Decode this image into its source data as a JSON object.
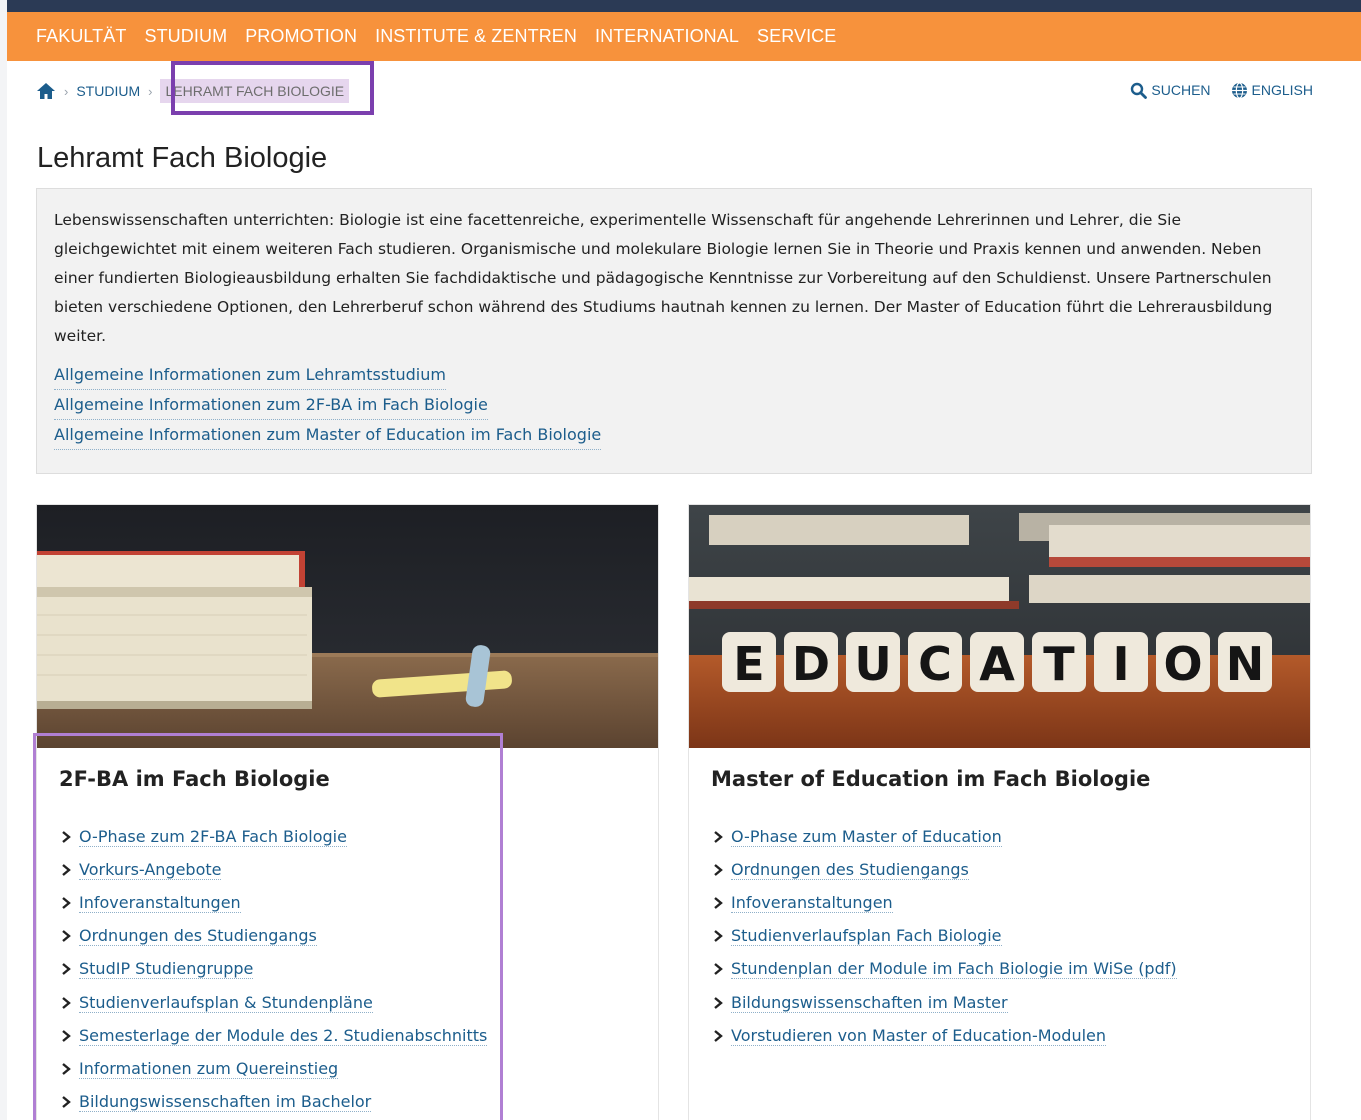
{
  "nav": {
    "items": [
      "FAKULTÄT",
      "STUDIUM",
      "PROMOTION",
      "INSTITUTE & ZENTREN",
      "INTERNATIONAL",
      "SERVICE"
    ]
  },
  "breadcrumb": {
    "home_icon": "home-icon",
    "studium": "STUDIUM",
    "current": "LEHRAMT FACH BIOLOGIE"
  },
  "utility": {
    "search_label": "SUCHEN",
    "language_label": "ENGLISH"
  },
  "page": {
    "title": "Lehramt Fach Biologie"
  },
  "intro": {
    "text": "Lebenswissenschaften unterrichten: Biologie ist eine facettenreiche, experimentelle Wissenschaft für angehende Lehrerinnen und Lehrer, die Sie gleichgewichtet mit einem weiteren Fach studieren. Organismische und molekulare Biologie lernen Sie in Theorie und Praxis kennen und anwenden. Neben einer fundierten Biologieausbildung erhalten Sie fachdidaktische und pädagogische Kenntnisse zur Vorbereitung auf den Schuldienst. Unsere Partnerschulen bieten verschiedene Optionen, den Lehrerberuf schon während des Studiums hautnah kennen zu lernen. Der Master of Education führt die Lehrerausbildung weiter.",
    "links": [
      "Allgemeine Informationen zum Lehramtsstudium",
      "Allgemeine Informationen zum 2F-BA im Fach Biologie",
      "Allgemeine Informationen zum Master of Education im Fach Biologie"
    ]
  },
  "cards": [
    {
      "title": "2F-BA im Fach Biologie",
      "links": [
        "O-Phase zum 2F-BA Fach Biologie",
        "Vorkurs-Angebote",
        "Infoveranstaltungen",
        "Ordnungen des Studiengangs",
        "StudIP Studiengruppe",
        "Studienverlaufsplan & Stundenpläne",
        "Semesterlage der Module des 2. Studienabschnitts",
        "Informationen zum Quereinstieg",
        "Bildungswissenschaften im Bachelor"
      ]
    },
    {
      "title": "Master of Education im Fach Biologie",
      "image_text": [
        "E",
        "D",
        "U",
        "C",
        "A",
        "T",
        "I",
        "O",
        "N"
      ],
      "links": [
        "O-Phase zum Master of Education",
        "Ordnungen des Studiengangs",
        "Infoveranstaltungen",
        "Studienverlaufsplan Fach Biologie",
        "Stundenplan der Module im Fach Biologie im WiSe (pdf)",
        "Bildungswissenschaften im Master",
        "Vorstudieren von Master of Education-Modulen"
      ]
    }
  ],
  "colors": {
    "nav_bg": "#f7923c",
    "link": "#1c5d8c",
    "highlight": "#7b3fae"
  }
}
